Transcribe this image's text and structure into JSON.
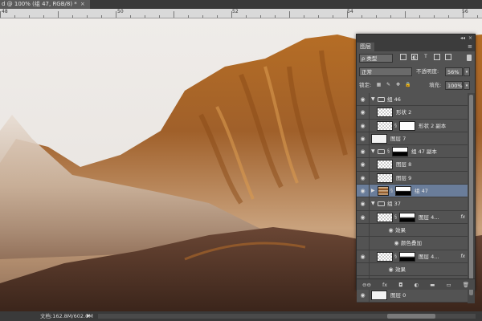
{
  "document": {
    "tab_title": "d @ 100% (组 47, RGB/8) *",
    "close_glyph": "×"
  },
  "ruler": {
    "numbers": [
      "48",
      "50",
      "52",
      "54",
      "56"
    ]
  },
  "status": {
    "doc_size": "文档:162.8M/602.0M",
    "arrow": "▶"
  },
  "layers_panel": {
    "collapse_glyph": "◂◂",
    "close_glyph": "×",
    "tab_label": "图层",
    "menu_icon": "menu-icon",
    "filter": {
      "label": "ρ 类型",
      "icons": [
        "image-filter-icon",
        "adjustment-filter-icon",
        "text-filter-icon",
        "shape-filter-icon",
        "smart-object-filter-icon"
      ]
    },
    "blend_mode": "正常",
    "opacity_label": "不透明度:",
    "opacity_value": "56%",
    "lock_label": "锁定:",
    "fill_label": "填充:",
    "fill_value": "100%",
    "layers": [
      {
        "name": "组 46",
        "type": "group",
        "expanded": true,
        "indent": 0
      },
      {
        "name": "形状 2",
        "type": "layer",
        "thumb": "checker",
        "indent": 1
      },
      {
        "name": "形状 2 副本",
        "type": "masked",
        "thumb": "checker",
        "mask": "white",
        "indent": 1
      },
      {
        "name": "图层 7",
        "type": "layer",
        "thumb": "white",
        "indent": 0
      },
      {
        "name": "组 47 副本",
        "type": "group-mask",
        "expanded": true,
        "mask": "half",
        "indent": 0
      },
      {
        "name": "图层 8",
        "type": "layer",
        "thumb": "checker",
        "indent": 1
      },
      {
        "name": "图层 9",
        "type": "layer",
        "thumb": "checker",
        "indent": 1
      },
      {
        "name": "组 47",
        "type": "group-mask",
        "expanded": false,
        "mask": "half",
        "selected": true,
        "thumb": "photo",
        "indent": 0
      },
      {
        "name": "组 37",
        "type": "group",
        "expanded": true,
        "indent": 0
      },
      {
        "name": "图层 4...",
        "type": "masked",
        "thumb": "checker",
        "mask": "dark",
        "fx": "fx",
        "indent": 1
      },
      {
        "name": "效果",
        "type": "effect-header",
        "indent": 2
      },
      {
        "name": "颜色叠加",
        "type": "effect",
        "indent": 3
      },
      {
        "name": "图层 4...",
        "type": "masked",
        "thumb": "checker",
        "mask": "dark",
        "fx": "fx",
        "indent": 1
      },
      {
        "name": "效果",
        "type": "effect-header",
        "indent": 2
      },
      {
        "name": "颜色叠加",
        "type": "effect",
        "indent": 3
      },
      {
        "name": "图层 0",
        "type": "layer",
        "thumb": "white",
        "indent": 0
      }
    ],
    "footer_icons": [
      "link-icon",
      "fx-icon",
      "mask-icon",
      "adjustment-icon",
      "new-group-icon",
      "new-layer-icon",
      "trash-icon"
    ],
    "footer_glyphs": [
      "⊖⊖",
      "fx",
      "◘",
      "◐",
      "▬",
      "▭",
      "🗑"
    ]
  },
  "colors": {
    "panel_bg": "#535353",
    "selected_row": "#6a7d9a",
    "canvas_bg": "#ece9e5"
  }
}
